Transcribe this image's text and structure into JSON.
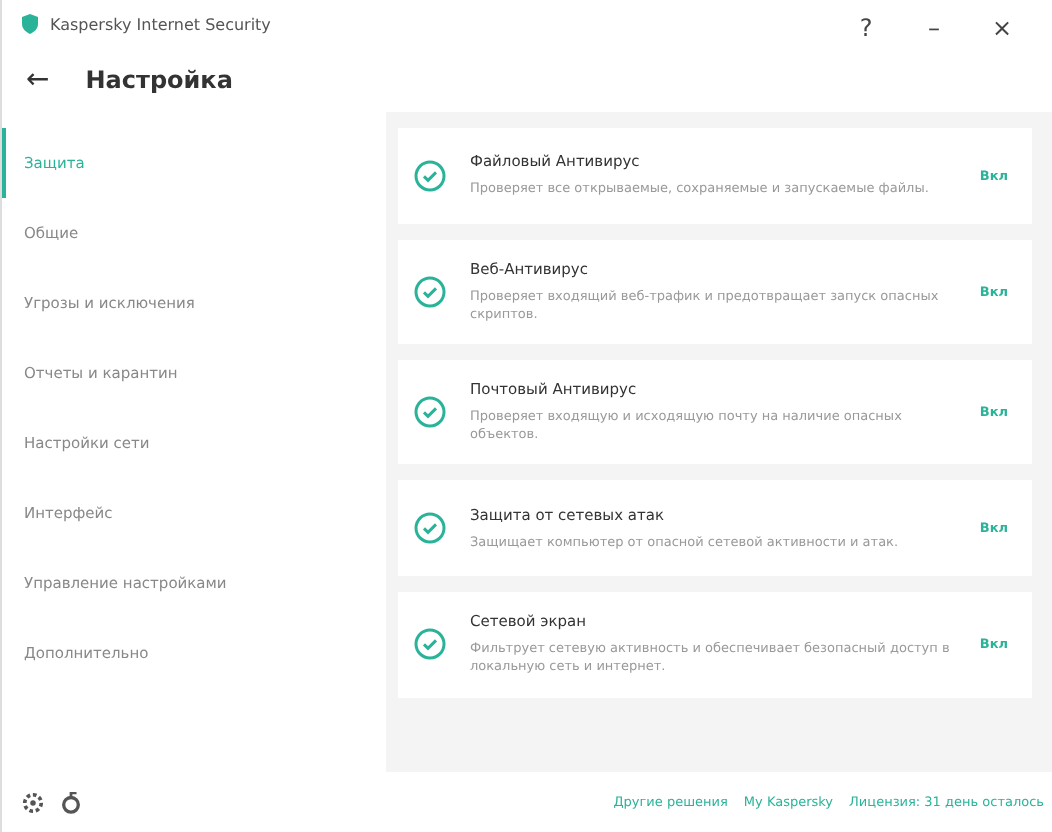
{
  "window": {
    "title": "Kaspersky Internet Security",
    "buttons": [
      "?",
      "–",
      "×"
    ]
  },
  "header": {
    "back": "←",
    "title": "Настройка"
  },
  "sidebar": {
    "items": [
      {
        "label": "Защита",
        "selected": true
      },
      {
        "label": "Общие",
        "selected": false
      },
      {
        "label": "Угрозы и исключения",
        "selected": false
      },
      {
        "label": "Отчеты и карантин",
        "selected": false
      },
      {
        "label": "Настройки сети",
        "selected": false
      },
      {
        "label": "Интерфейс",
        "selected": false
      },
      {
        "label": "Управление настройками",
        "selected": false
      },
      {
        "label": "Дополнительно",
        "selected": false
      }
    ]
  },
  "components": [
    {
      "name": "Файловый Антивирус",
      "description": "Проверяет все открываемые, сохраняемые и запускаемые файлы.",
      "status": "Вкл",
      "on": true
    },
    {
      "name": "Веб-Антивирус",
      "description": "Проверяет входящий веб-трафик и предотвращает запуск опасных скриптов.",
      "status": "Вкл",
      "on": true
    },
    {
      "name": "Почтовый Антивирус",
      "description": "Проверяет входящую и исходящую почту на наличие опасных объектов.",
      "status": "Вкл",
      "on": true
    },
    {
      "name": "Защита от сетевых атак",
      "description": "Защищает компьютер от опасной сетевой активности и атак.",
      "status": "Вкл",
      "on": true
    },
    {
      "name": "Сетевой экран",
      "description": "Фильтрует сетевую активность и обеспечивает безопасный доступ в локальную сеть и интернет.",
      "status": "Вкл",
      "on": true
    }
  ],
  "footer": {
    "links": [
      "Другие решения",
      "My Kaspersky",
      "Лицензия: 31 день осталось"
    ]
  }
}
